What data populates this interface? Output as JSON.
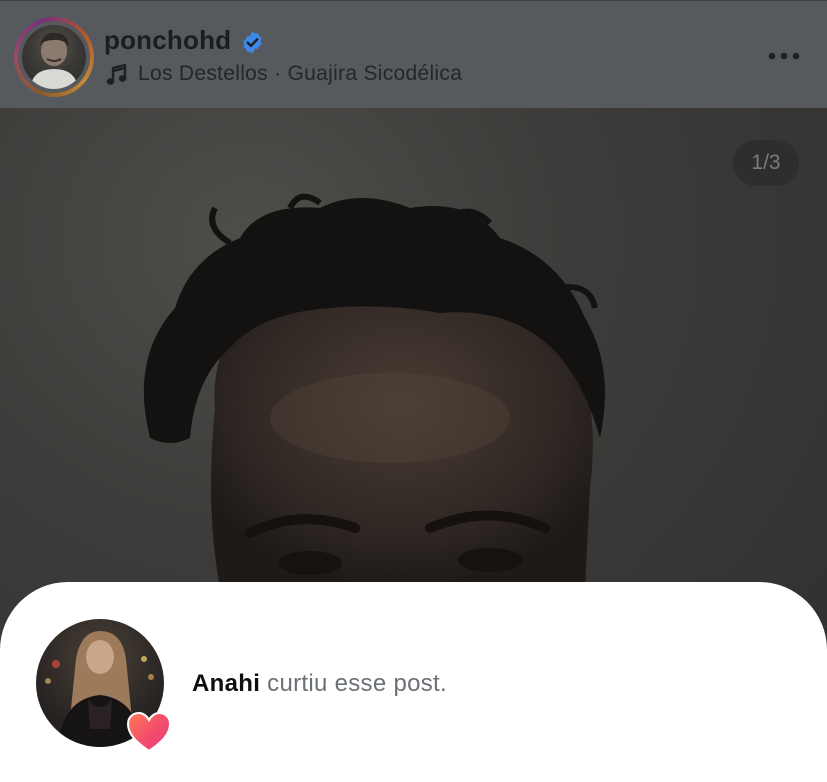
{
  "post": {
    "username": "ponchohd",
    "verified": true,
    "audio": "Los Destellos · Guajira Sicodélica",
    "slide_counter": "1/3",
    "icons": {
      "avatar": "profile-avatar-with-story-ring",
      "verified": "verified-badge-icon",
      "music": "music-note-icon",
      "more": "more-options-icon"
    },
    "colors": {
      "verified": "#3d89e8",
      "header_bg": "#56595d"
    }
  },
  "like_notice": {
    "name": "Anahi",
    "text": "curtiu esse post.",
    "icon": "heart-icon",
    "heart_color": "#f34c6b"
  }
}
